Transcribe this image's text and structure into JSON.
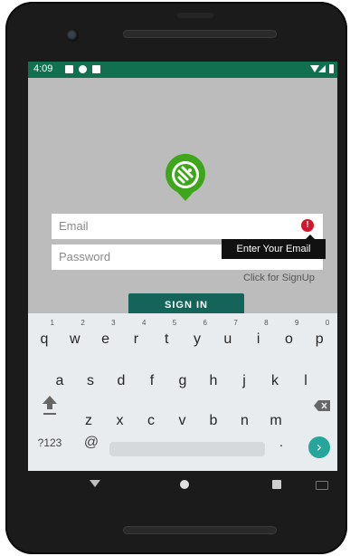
{
  "status_bar": {
    "time": "4:09",
    "icons": [
      "notification-icon",
      "cast-icon",
      "storage-icon"
    ],
    "right_icons": [
      "wifi-icon",
      "signal-icon",
      "battery-icon"
    ],
    "color": "#10704f"
  },
  "form": {
    "email_placeholder": "Email",
    "password_placeholder": "Password",
    "error_tooltip": "Enter Your Email",
    "error_icon": "!",
    "signup_link": "Click for SignUp",
    "signin_label": "SIGN IN",
    "accent": "#14645a",
    "error_color": "#d6152c"
  },
  "keyboard": {
    "row1": [
      "q",
      "w",
      "e",
      "r",
      "t",
      "y",
      "u",
      "i",
      "o",
      "p"
    ],
    "row1_hints": [
      "1",
      "2",
      "3",
      "4",
      "5",
      "6",
      "7",
      "8",
      "9",
      "0"
    ],
    "row2": [
      "a",
      "s",
      "d",
      "f",
      "g",
      "h",
      "j",
      "k",
      "l"
    ],
    "row3": [
      "z",
      "x",
      "c",
      "v",
      "b",
      "n",
      "m"
    ],
    "symbols_key": "?123",
    "at_key": "@",
    "period_key": ".",
    "go_icon": "›"
  },
  "nav": {
    "icons": [
      "back-icon",
      "home-icon",
      "recents-icon",
      "keyboard-icon"
    ]
  }
}
